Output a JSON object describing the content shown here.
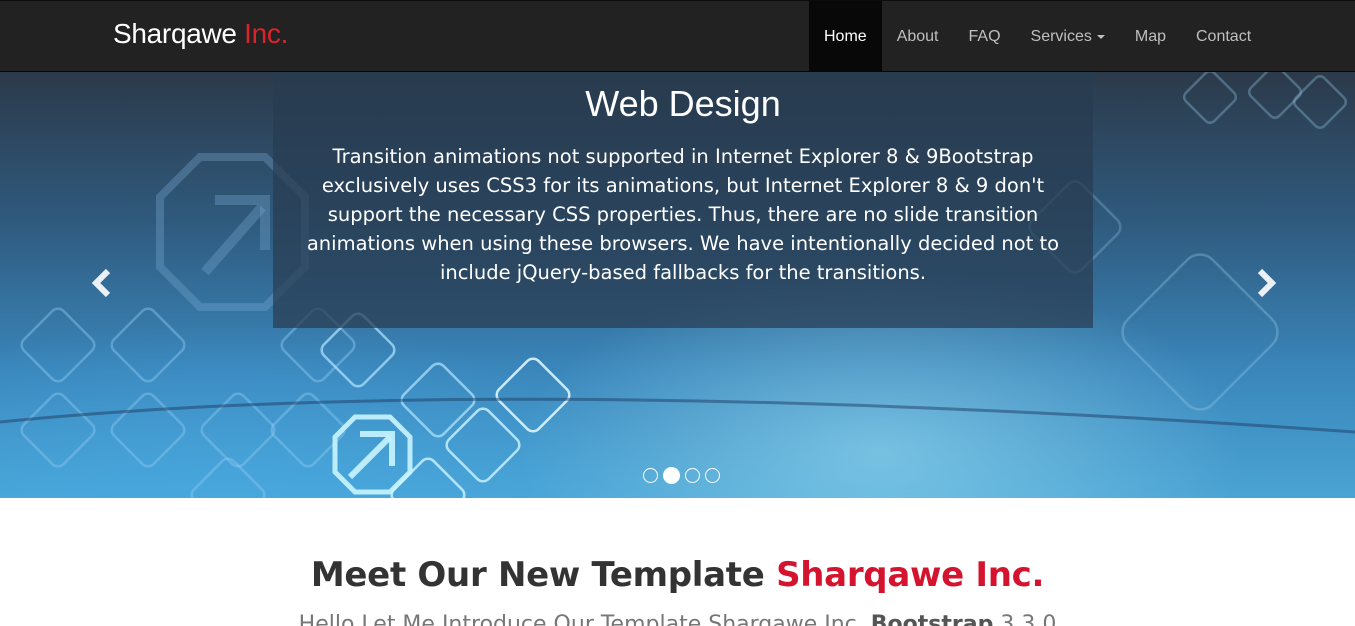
{
  "navbar": {
    "brand_main": "Sharqawe",
    "brand_accent": "Inc.",
    "items": [
      {
        "label": "Home",
        "active": true
      },
      {
        "label": "About"
      },
      {
        "label": "FAQ"
      },
      {
        "label": "Services",
        "dropdown": true
      },
      {
        "label": "Map"
      },
      {
        "label": "Contact"
      }
    ]
  },
  "carousel": {
    "title": "Web Design",
    "text": "Transition animations not supported in Internet Explorer 8 & 9Bootstrap exclusively uses CSS3 for its animations, but Internet Explorer 8 & 9 don't support the necessary CSS properties. Thus, there are no slide transition animations when using these browsers. We have intentionally decided not to include jQuery-based fallbacks for the transitions.",
    "prev_icon": "chevron-left-icon",
    "next_icon": "chevron-right-icon",
    "slide_count": 4,
    "active_slide": 2
  },
  "section": {
    "title_main": "Meet Our New Template",
    "title_accent": "Sharqawe Inc.",
    "subtitle_main": "Hello Let Me Introduce Our Template Sharqawe Inc.",
    "subtitle_bold": "Bootstrap",
    "subtitle_version": "3.3.0"
  },
  "colors": {
    "navbar_bg": "#222222",
    "accent": "#d9252a",
    "caption_bg": "rgba(40,60,80,0.72)"
  }
}
